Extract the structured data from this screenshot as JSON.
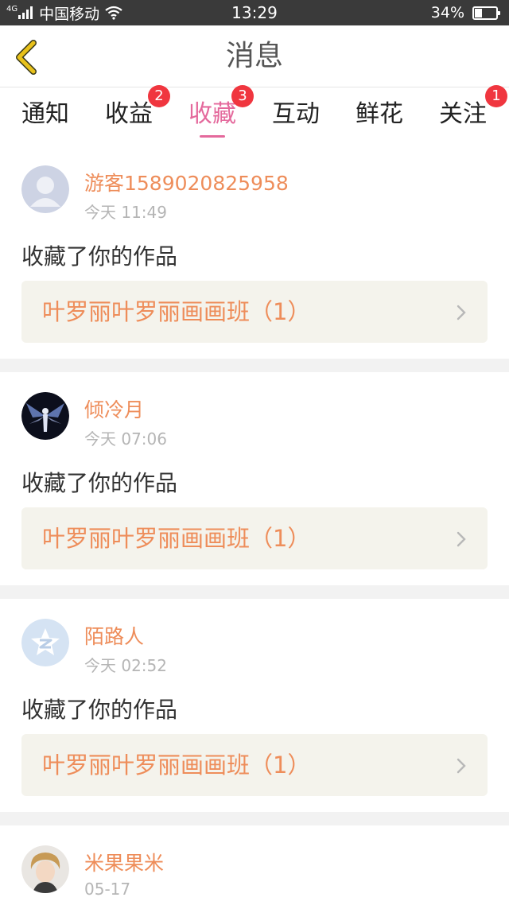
{
  "status_bar": {
    "network": "4G",
    "carrier": "中国移动",
    "time": "13:29",
    "battery_percent": "34%",
    "battery_level": 0.34
  },
  "header": {
    "title": "消息",
    "back_icon": "chevron-left-icon",
    "accent_color": "#e8c11a"
  },
  "tabs": [
    {
      "label": "通知",
      "badge": null,
      "active": false
    },
    {
      "label": "收益",
      "badge": "2",
      "active": false
    },
    {
      "label": "收藏",
      "badge": "3",
      "active": true
    },
    {
      "label": "互动",
      "badge": null,
      "active": false
    },
    {
      "label": "鲜花",
      "badge": null,
      "active": false
    },
    {
      "label": "关注",
      "badge": "1",
      "active": false
    }
  ],
  "colors": {
    "active_tab": "#e4699c",
    "badge": "#f0363f",
    "name_text": "#ee8d5a",
    "work_bg": "#f4f3ec"
  },
  "feed": [
    {
      "user": "游客1589020825958",
      "time": "今天 11:49",
      "action": "收藏了你的作品",
      "work": "叶罗丽叶罗丽画画班（1）",
      "avatar": "default-person-avatar"
    },
    {
      "user": "倾冷月",
      "time": "今天 07:06",
      "action": "收藏了你的作品",
      "work": "叶罗丽叶罗丽画画班（1）",
      "avatar": "dark-angel-avatar"
    },
    {
      "user": "陌路人",
      "time": "今天 02:52",
      "action": "收藏了你的作品",
      "work": "叶罗丽叶罗丽画画班（1）",
      "avatar": "qzone-avatar"
    },
    {
      "user": "米果果米",
      "time": "05-17",
      "action": "",
      "work": "",
      "avatar": "photo-avatar"
    }
  ]
}
